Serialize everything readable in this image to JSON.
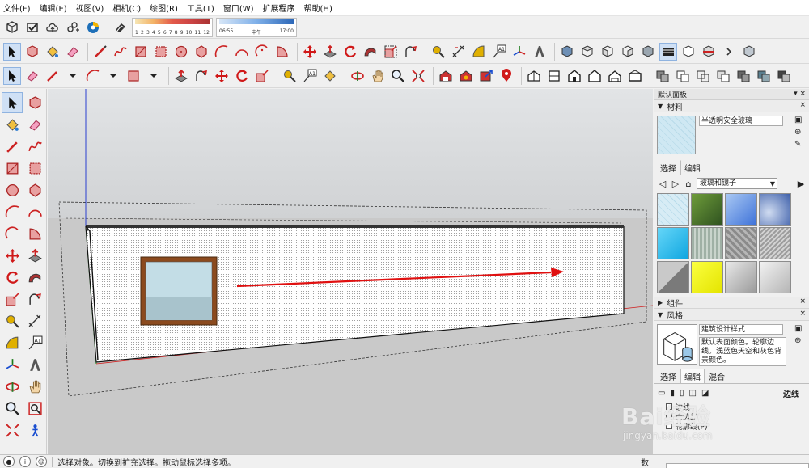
{
  "menu": [
    "文件(F)",
    "编辑(E)",
    "视图(V)",
    "相机(C)",
    "绘图(R)",
    "工具(T)",
    "窗口(W)",
    "扩展程序",
    "帮助(H)"
  ],
  "shadow": {
    "scale": [
      "1",
      "2",
      "3",
      "4",
      "5",
      "6",
      "7",
      "8",
      "9",
      "10",
      "11",
      "12"
    ],
    "time_start": "06:55",
    "time_mid": "中午",
    "time_end": "17:00"
  },
  "tray": {
    "title": "默认面板",
    "materials": {
      "header": "材料",
      "current_name": "半透明安全玻璃",
      "tab_select": "选择",
      "tab_edit": "编辑",
      "library": "玻璃和镜子",
      "swatch_colors": [
        "#cfe8f3",
        "#4e7a2e",
        "#6e9ee8",
        "#5b7fc0",
        "#2fc0f0",
        "#a8b7ae",
        "#9a9a9a",
        "#bdbdbd",
        "#8a8a8a",
        "#f4f400",
        "#b8b8b8",
        "#d2d2d2"
      ]
    },
    "components": {
      "header": "组件"
    },
    "styles": {
      "header": "风格",
      "current_name": "建筑设计样式",
      "description": "默认表面颜色。轮廓边线。浅蓝色天空和灰色背景颜色。",
      "tab_select": "选择",
      "tab_edit": "编辑",
      "tab_mix": "混合",
      "edge_label": "边线",
      "list": [
        "边线",
        "后边线",
        "轮廓线(P)"
      ]
    }
  },
  "status": {
    "message": "选择对象。切换到扩充选择。拖动鼠标选择多项。",
    "measure_label": "数值"
  },
  "colors": {
    "sky": "#cfd3d6",
    "ground": "#c8c8c8",
    "arrow": "#e01010",
    "frame": "#8b4a1e"
  },
  "watermark": {
    "brand": "Bai经验",
    "url": "jingyan.baidu.com"
  }
}
